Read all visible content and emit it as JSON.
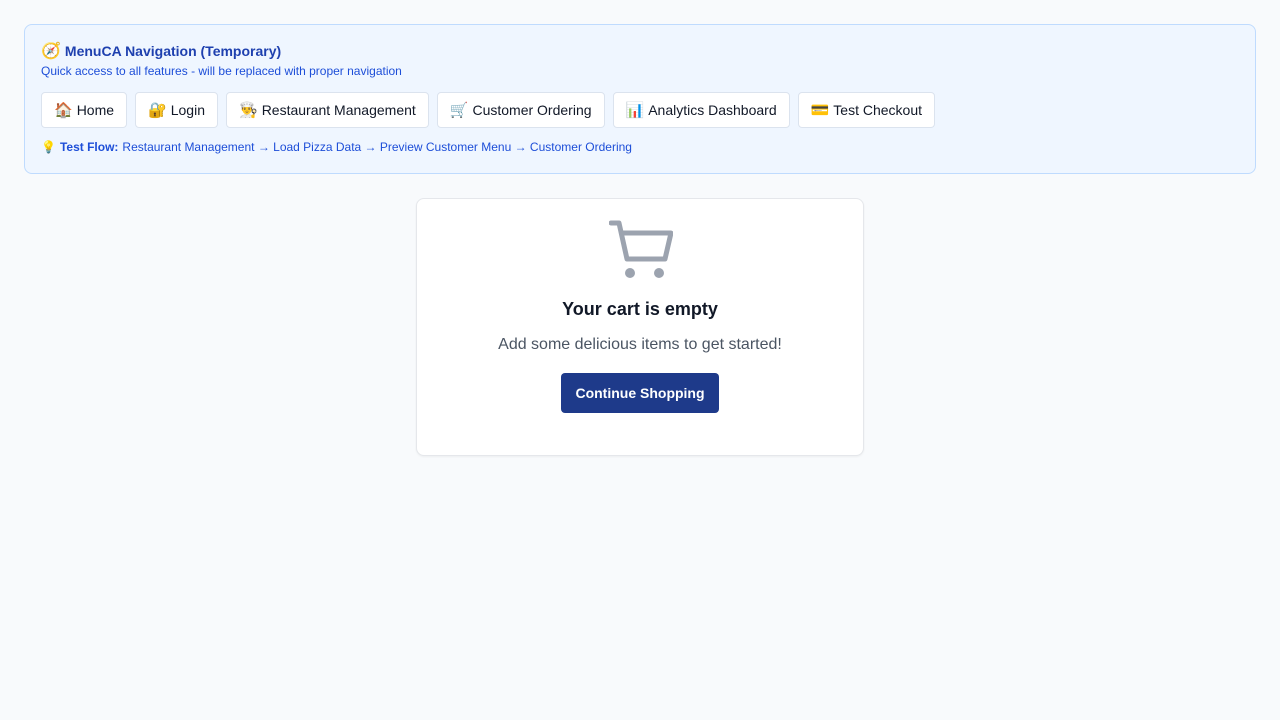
{
  "nav": {
    "title_icon": "🧭",
    "title": "MenuCA Navigation (Temporary)",
    "subtitle": "Quick access to all features - will be replaced with proper navigation",
    "buttons": [
      {
        "icon": "🏠",
        "label": "Home"
      },
      {
        "icon": "🔐",
        "label": "Login"
      },
      {
        "icon": "👨‍🍳",
        "label": "Restaurant Management"
      },
      {
        "icon": "🛒",
        "label": "Customer Ordering"
      },
      {
        "icon": "📊",
        "label": "Analytics Dashboard"
      },
      {
        "icon": "💳",
        "label": "Test Checkout"
      }
    ],
    "test_flow": {
      "icon": "💡",
      "label": "Test Flow:",
      "steps": "Restaurant Management → Load Pizza Data → Preview Customer Menu → Customer Ordering"
    }
  },
  "cart": {
    "icon": "shopping-cart-icon",
    "title": "Your cart is empty",
    "subtitle": "Add some delicious items to get started!",
    "button_label": "Continue Shopping"
  },
  "colors": {
    "background": "#f8fafc",
    "nav_background": "#eff6ff",
    "nav_text": "#1e40af",
    "primary_button": "#1e3a8a",
    "cart_icon": "#9ca3af"
  }
}
